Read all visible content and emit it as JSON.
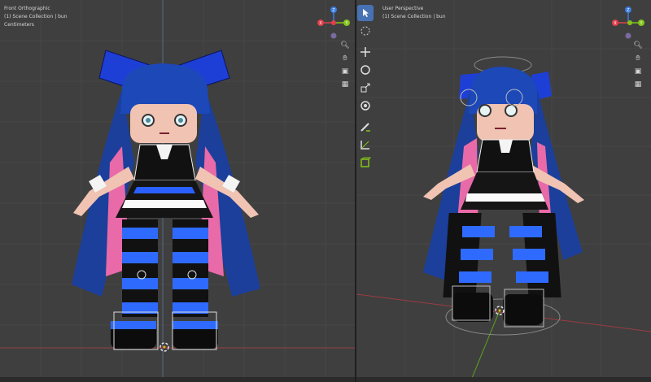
{
  "left_view": {
    "title": "Front Orthographic",
    "collection": "(1) Scene Collection | bun",
    "units": "Centimeters"
  },
  "right_view": {
    "title": "User Perspective",
    "collection": "(1) Scene Collection | bun"
  },
  "gizmo": {
    "x_label": "X",
    "y_label": "Y",
    "z_label": "Z"
  },
  "nav_icons": [
    "zoom-icon",
    "hand-pan-icon",
    "camera-icon",
    "grid-icon"
  ],
  "tools": [
    "select-box-tool",
    "cursor-tool",
    "move-tool",
    "rotate-tool",
    "scale-tool",
    "transform-tool",
    "annotate-tool",
    "measure-tool",
    "add-cube-tool"
  ],
  "colors": {
    "viewport_bg": "#3f3f3f",
    "x_axis": "#e0404c",
    "y_axis": "#84c51a",
    "z_axis": "#3b7de0",
    "accent": "#4772b3"
  }
}
